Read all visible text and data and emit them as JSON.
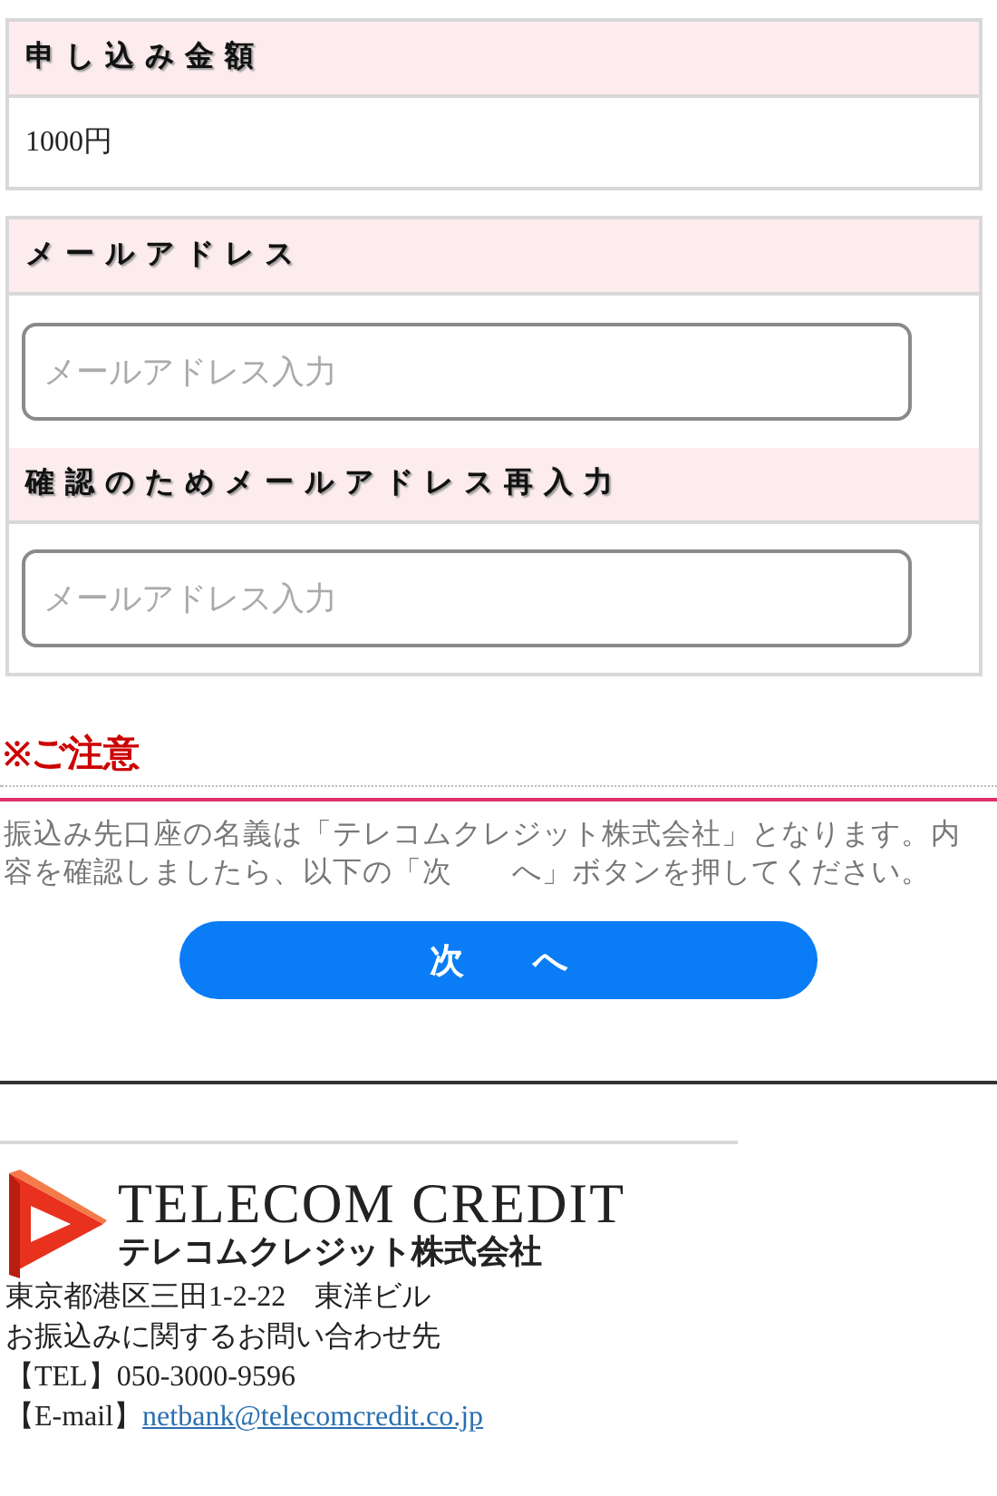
{
  "amount_section": {
    "heading": "申し込み金額",
    "value": "1000円"
  },
  "email_section": {
    "fields": [
      {
        "heading": "メールアドレス",
        "placeholder": "メールアドレス入力"
      },
      {
        "heading": "確認のためメールアドレス再入力",
        "placeholder": "メールアドレス入力"
      }
    ]
  },
  "notice": {
    "mark": "※",
    "title": "ご注意",
    "text": "振込み先口座の名義は「テレコムクレジット株式会社」となります。内容を確認しましたら、以下の「次　　へ」ボタンを押してください。"
  },
  "next_button": {
    "label": "次　　へ"
  },
  "footer": {
    "logo": {
      "title": "TELECOM CREDIT",
      "subtitle": "テレコムクレジット株式会社"
    },
    "lines": [
      {
        "kind": "text",
        "text": "東京都港区三田1-2-22　東洋ビル"
      },
      {
        "kind": "text",
        "text": "お振込みに関するお問い合わせ先"
      },
      {
        "kind": "text",
        "text": "【TEL】050-3000-9596"
      },
      {
        "kind": "link",
        "label": "【E-mail】",
        "link": "netbank@telecomcredit.co.jp"
      }
    ]
  }
}
